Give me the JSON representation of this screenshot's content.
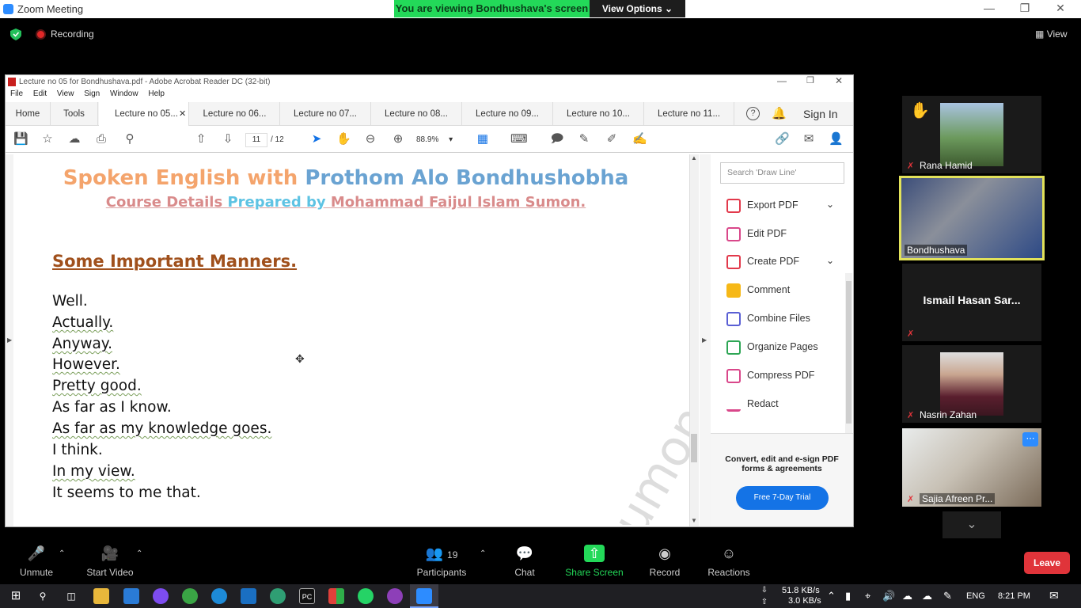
{
  "zoom": {
    "window_title": "Zoom Meeting",
    "viewing_banner": "You are viewing Bondhushava's screen",
    "view_options": "View Options",
    "recording": "Recording",
    "view_label": "View"
  },
  "acrobat": {
    "window_title": "Lecture no 05 for Bondhushava.pdf - Adobe Acrobat Reader DC (32-bit)",
    "menu": [
      "File",
      "Edit",
      "View",
      "Sign",
      "Window",
      "Help"
    ],
    "tabs": [
      "Home",
      "Tools",
      "Lecture no 05...",
      "Lecture no 06...",
      "Lecture no 07...",
      "Lecture no 08...",
      "Lecture no 09...",
      "Lecture no 10...",
      "Lecture no 11..."
    ],
    "sign_in": "Sign In",
    "page_current": "11",
    "page_total": "/ 12",
    "zoom_level": "88.9%",
    "search_placeholder": "Search 'Draw Line'",
    "tools": [
      {
        "label": "Export PDF",
        "color": "#e2394b",
        "has_chevron": true
      },
      {
        "label": "Edit PDF",
        "color": "#d9478a",
        "has_chevron": false
      },
      {
        "label": "Create PDF",
        "color": "#e2394b",
        "has_chevron": true
      },
      {
        "label": "Comment",
        "color": "#f6b817",
        "has_chevron": false
      },
      {
        "label": "Combine Files",
        "color": "#5a5fd4",
        "has_chevron": false
      },
      {
        "label": "Organize Pages",
        "color": "#2ea655",
        "has_chevron": false
      },
      {
        "label": "Compress PDF",
        "color": "#d9478a",
        "has_chevron": false
      },
      {
        "label": "Redact",
        "color": "#d9478a",
        "has_chevron": false
      }
    ],
    "promo_text": "Convert, edit and e-sign PDF forms & agreements",
    "trial_button": "Free 7-Day Trial"
  },
  "document": {
    "title_part1": "Spoken English with ",
    "title_part2": "Prothom Alo Bondhushobha",
    "subtitle_part1": "Course Details ",
    "subtitle_part2": "Prepared by ",
    "subtitle_part3": "Mohammad Faijul Islam Sumon.",
    "heading": "Some Important Manners.",
    "lines": [
      {
        "text": "Well.",
        "underline": false
      },
      {
        "text": "Actually.",
        "underline": true
      },
      {
        "text": "Anyway.",
        "underline": true
      },
      {
        "text": "However.",
        "underline": true
      },
      {
        "text": "Pretty good.",
        "underline": true
      },
      {
        "text": "As far as I know.",
        "underline": false
      },
      {
        "text": "As far as my knowledge goes.",
        "underline": true
      },
      {
        "text": "I think.",
        "underline": false
      },
      {
        "text": "In my view.",
        "underline": true
      },
      {
        "text": "It seems to me that.",
        "underline": false
      }
    ],
    "watermark": "Sumon"
  },
  "participants": [
    {
      "name": "Rana Hamid"
    },
    {
      "name": "Bondhushava"
    },
    {
      "name": "Ismail Hasan Sar..."
    },
    {
      "name": "Nasrin Zahan"
    },
    {
      "name": "Sajia Afreen Pr..."
    }
  ],
  "meeting_bar": {
    "unmute": "Unmute",
    "start_video": "Start Video",
    "participants_count": "19",
    "participants": "Participants",
    "chat": "Chat",
    "share_screen": "Share Screen",
    "record": "Record",
    "reactions": "Reactions",
    "leave": "Leave"
  },
  "taskbar": {
    "upload": "51.8 KB/s",
    "download": "3.0 KB/s",
    "language": "ENG",
    "time": "8:21 PM"
  }
}
